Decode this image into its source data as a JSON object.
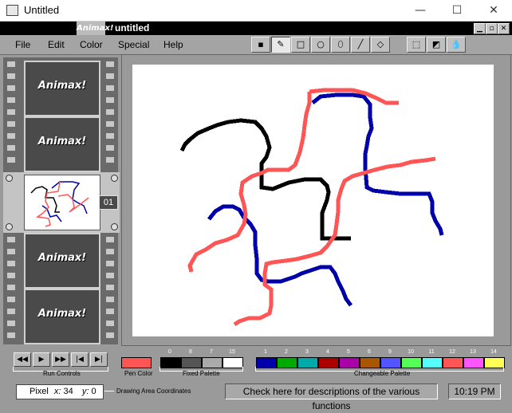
{
  "window": {
    "title": "Untitled",
    "min": "—",
    "max": "☐",
    "close": "✕"
  },
  "app": {
    "logo": "Animax!",
    "document": "untitled"
  },
  "menu": [
    "File",
    "Edit",
    "Color",
    "Special",
    "Help"
  ],
  "frame_label": "Animax!",
  "current_frame": "01",
  "run_controls_label": "Run Controls",
  "pen_color_label": "Pen Color",
  "fixed_palette_label": "Fixed Palette",
  "changeable_palette_label": "Changeable Palette",
  "pen_color": "#ff5555",
  "fixed_palette": [
    {
      "num": "0",
      "color": "#000000"
    },
    {
      "num": "8",
      "color": "#555555"
    },
    {
      "num": "7",
      "color": "#aaaaaa"
    },
    {
      "num": "15",
      "color": "#ffffff"
    }
  ],
  "changeable_palette": [
    {
      "num": "1",
      "color": "#0000aa"
    },
    {
      "num": "2",
      "color": "#00aa00"
    },
    {
      "num": "3",
      "color": "#00aaaa"
    },
    {
      "num": "4",
      "color": "#aa0000"
    },
    {
      "num": "5",
      "color": "#aa00aa"
    },
    {
      "num": "6",
      "color": "#aa5500"
    },
    {
      "num": "9",
      "color": "#5555ff"
    },
    {
      "num": "10",
      "color": "#55ff55"
    },
    {
      "num": "11",
      "color": "#55ffff"
    },
    {
      "num": "12",
      "color": "#ff5555"
    },
    {
      "num": "13",
      "color": "#ff55ff"
    },
    {
      "num": "14",
      "color": "#ffff55"
    }
  ],
  "coords": {
    "mode": "Pixel",
    "x_label": "x:",
    "x": "34",
    "y_label": "y:",
    "y": "0",
    "caption": "Drawing Area Coordinates"
  },
  "status_text": "Check here for descriptions of the various functions",
  "clock": "10:19 PM"
}
